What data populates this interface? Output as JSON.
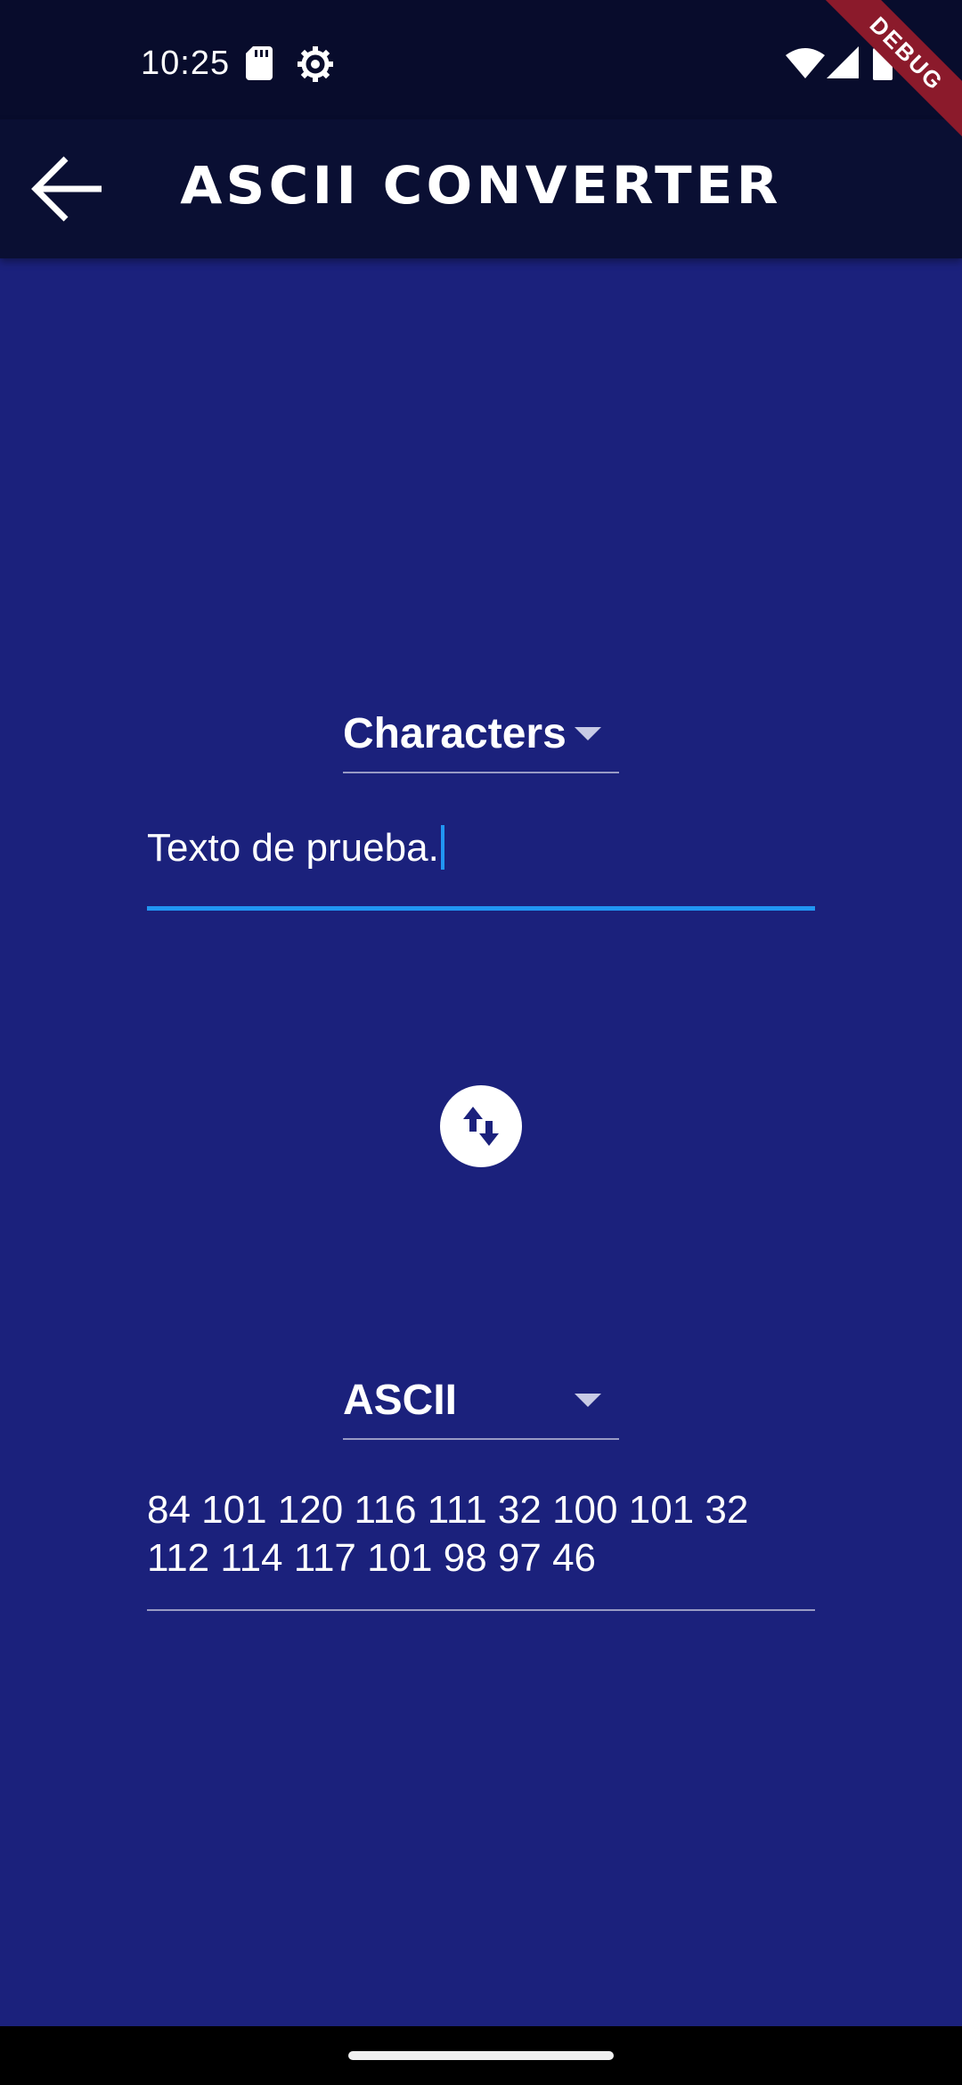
{
  "status_bar": {
    "time": "10:25",
    "left_icons": [
      "sd-card-icon",
      "settings-gear-icon"
    ],
    "right_icons": [
      "wifi-icon",
      "signal-icon",
      "battery-icon"
    ]
  },
  "debug_banner": "DEBUG",
  "app_bar": {
    "title": "ASCII CONVERTER",
    "back_icon": "arrow-back-icon"
  },
  "input_section": {
    "dropdown_value": "Characters",
    "text_value": "Texto de prueba."
  },
  "swap_button": {
    "icon": "swap-vertical-icon"
  },
  "output_section": {
    "dropdown_value": "ASCII",
    "text_line_1": "84 101 120 116 111 32 100 101 32",
    "text_line_2": "112 114 117 101 98 97 46"
  },
  "colors": {
    "background": "#1b217c",
    "app_bar": "#0a0f33",
    "status_bar": "#080c2c",
    "accent": "#2196f3",
    "debug_ribbon": "#8b1a2b"
  }
}
